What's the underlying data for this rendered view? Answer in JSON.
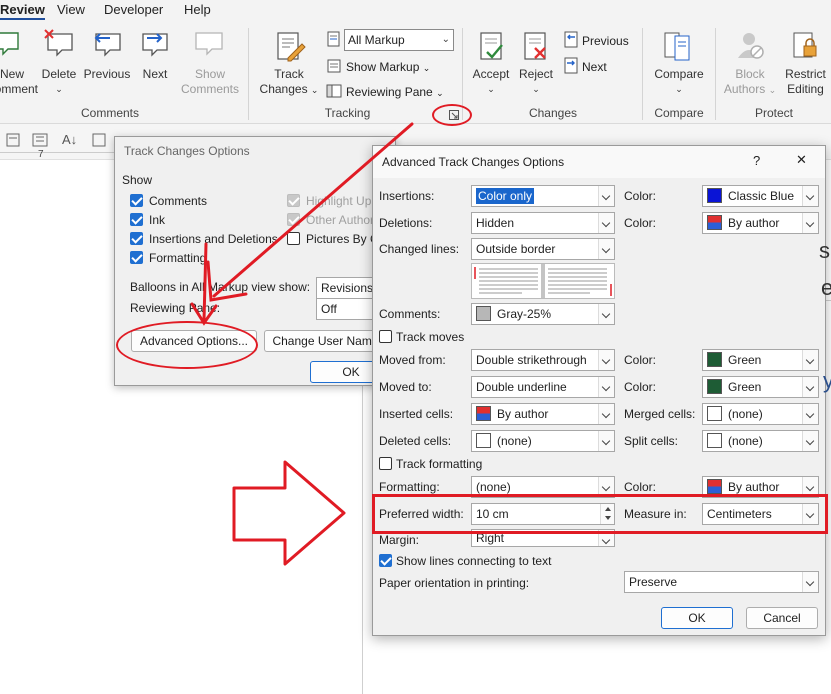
{
  "ribbon": {
    "tabs": [
      "Review",
      "View",
      "Developer",
      "Help"
    ],
    "comments": {
      "new_line1": "New",
      "new_line2": "Comment",
      "delete": "Delete",
      "previous": "Previous",
      "next": "Next",
      "show_line1": "Show",
      "show_line2": "Comments",
      "group": "Comments"
    },
    "tracking": {
      "track_line1": "Track",
      "track_line2": "Changes",
      "markup_value": "All Markup",
      "show_markup": "Show Markup",
      "reviewing_pane": "Reviewing Pane",
      "group": "Tracking"
    },
    "changes": {
      "accept": "Accept",
      "reject": "Reject",
      "previous": "Previous",
      "next": "Next",
      "group": "Changes"
    },
    "compare": {
      "label": "Compare",
      "group": "Compare"
    },
    "protect": {
      "block_line1": "Block",
      "block_line2": "Authors",
      "restrict_line1": "Restrict",
      "restrict_line2": "Editing",
      "group": "Protect"
    }
  },
  "ruler": {
    "tick": "7"
  },
  "track_changes_options": {
    "title": "Track Changes Options",
    "show_heading": "Show",
    "checkboxes": [
      {
        "label": "Comments",
        "checked": true
      },
      {
        "label": "Ink",
        "checked": true
      },
      {
        "label": "Insertions and Deletions",
        "checked": true
      },
      {
        "label": "Formatting",
        "checked": true
      }
    ],
    "right_checkboxes": [
      {
        "label": "Highlight Up",
        "disabled": true
      },
      {
        "label": "Other Author",
        "disabled": true
      },
      {
        "label": "Pictures By Co",
        "disabled": false
      }
    ],
    "balloons_label": "Balloons in All Markup view show:",
    "balloons_value": "Revisions",
    "reviewing_pane_label": "Reviewing Pane:",
    "reviewing_pane_value": "Off",
    "advanced_button": "Advanced Options...",
    "change_user_button": "Change User Name...",
    "ok_button": "OK"
  },
  "advanced": {
    "title": "Advanced Track Changes Options",
    "help": "?",
    "close": "✕",
    "color_label": "Color:",
    "insertions": {
      "label": "Insertions:",
      "value": "Color only",
      "color": "Classic Blue"
    },
    "deletions": {
      "label": "Deletions:",
      "value": "Hidden",
      "color": "By author"
    },
    "changed_lines": {
      "label": "Changed lines:",
      "value": "Outside border"
    },
    "comments": {
      "label": "Comments:",
      "value": "Gray-25%"
    },
    "track_moves": "Track moves",
    "moved_from": {
      "label": "Moved from:",
      "value": "Double strikethrough",
      "color": "Green"
    },
    "moved_to": {
      "label": "Moved to:",
      "value": "Double underline",
      "color": "Green"
    },
    "inserted_cells": {
      "label": "Inserted cells:",
      "value": "By author"
    },
    "merged_cells": {
      "label": "Merged cells:",
      "value": "(none)"
    },
    "deleted_cells": {
      "label": "Deleted cells:",
      "value": "(none)"
    },
    "split_cells": {
      "label": "Split cells:",
      "value": "(none)"
    },
    "track_formatting": "Track formatting",
    "formatting": {
      "label": "Formatting:",
      "value": "(none)",
      "color": "By author"
    },
    "preferred_width": {
      "label": "Preferred width:",
      "value": "10 cm"
    },
    "measure_in": {
      "label": "Measure in:",
      "value": "Centimeters"
    },
    "margin": {
      "label": "Margin:",
      "value": "Right"
    },
    "show_lines": "Show lines connecting to text",
    "paper_orientation": {
      "label": "Paper orientation in printing:",
      "value": "Preserve"
    },
    "ok": "OK",
    "cancel": "Cancel"
  },
  "colors": {
    "annotation_red": "#e01b24",
    "classic_blue": "#0a14d6",
    "green": "#1e5c35",
    "gray25": "#b7b7b7",
    "selection_blue": "#1a66cc"
  }
}
